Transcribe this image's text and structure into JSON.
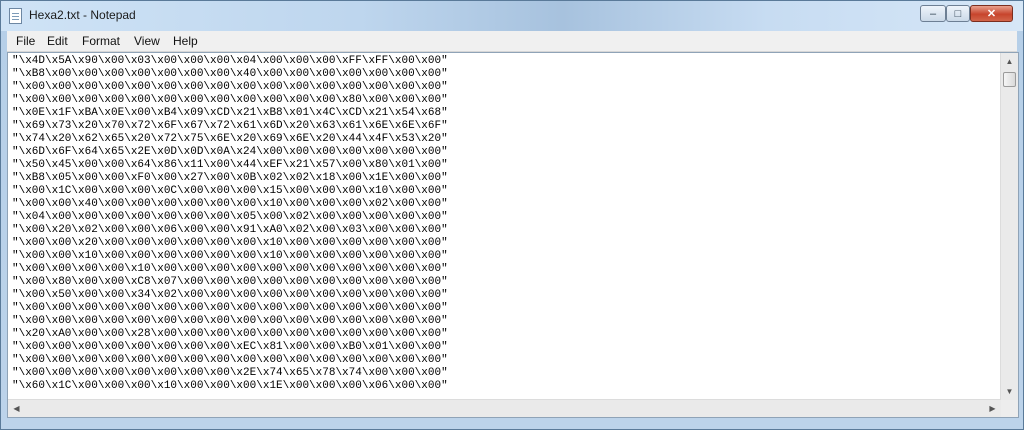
{
  "window": {
    "title": "Hexa2.txt - Notepad"
  },
  "menu": [
    "File",
    "Edit",
    "Format",
    "View",
    "Help"
  ],
  "controls": {
    "minimize": "–",
    "maximize": "□",
    "close": "✕"
  },
  "icons": {
    "app": "notepad-icon",
    "up": "▲",
    "down": "▼",
    "left": "◀",
    "right": "▶"
  },
  "editor": {
    "lines": [
      "\"\\x4D\\x5A\\x90\\x00\\x03\\x00\\x00\\x00\\x04\\x00\\x00\\x00\\xFF\\xFF\\x00\\x00\"",
      "\"\\xB8\\x00\\x00\\x00\\x00\\x00\\x00\\x00\\x40\\x00\\x00\\x00\\x00\\x00\\x00\\x00\"",
      "\"\\x00\\x00\\x00\\x00\\x00\\x00\\x00\\x00\\x00\\x00\\x00\\x00\\x00\\x00\\x00\\x00\"",
      "\"\\x00\\x00\\x00\\x00\\x00\\x00\\x00\\x00\\x00\\x00\\x00\\x00\\x80\\x00\\x00\\x00\"",
      "\"\\x0E\\x1F\\xBA\\x0E\\x00\\xB4\\x09\\xCD\\x21\\xB8\\x01\\x4C\\xCD\\x21\\x54\\x68\"",
      "\"\\x69\\x73\\x20\\x70\\x72\\x6F\\x67\\x72\\x61\\x6D\\x20\\x63\\x61\\x6E\\x6E\\x6F\"",
      "\"\\x74\\x20\\x62\\x65\\x20\\x72\\x75\\x6E\\x20\\x69\\x6E\\x20\\x44\\x4F\\x53\\x20\"",
      "\"\\x6D\\x6F\\x64\\x65\\x2E\\x0D\\x0D\\x0A\\x24\\x00\\x00\\x00\\x00\\x00\\x00\\x00\"",
      "\"\\x50\\x45\\x00\\x00\\x64\\x86\\x11\\x00\\x44\\xEF\\x21\\x57\\x00\\x80\\x01\\x00\"",
      "\"\\xB8\\x05\\x00\\x00\\xF0\\x00\\x27\\x00\\x0B\\x02\\x02\\x18\\x00\\x1E\\x00\\x00\"",
      "\"\\x00\\x1C\\x00\\x00\\x00\\x0C\\x00\\x00\\x00\\x15\\x00\\x00\\x00\\x10\\x00\\x00\"",
      "\"\\x00\\x00\\x40\\x00\\x00\\x00\\x00\\x00\\x00\\x10\\x00\\x00\\x00\\x02\\x00\\x00\"",
      "\"\\x04\\x00\\x00\\x00\\x00\\x00\\x00\\x00\\x05\\x00\\x02\\x00\\x00\\x00\\x00\\x00\"",
      "\"\\x00\\x20\\x02\\x00\\x00\\x06\\x00\\x00\\x91\\xA0\\x02\\x00\\x03\\x00\\x00\\x00\"",
      "\"\\x00\\x00\\x20\\x00\\x00\\x00\\x00\\x00\\x00\\x10\\x00\\x00\\x00\\x00\\x00\\x00\"",
      "\"\\x00\\x00\\x10\\x00\\x00\\x00\\x00\\x00\\x00\\x10\\x00\\x00\\x00\\x00\\x00\\x00\"",
      "\"\\x00\\x00\\x00\\x00\\x10\\x00\\x00\\x00\\x00\\x00\\x00\\x00\\x00\\x00\\x00\\x00\"",
      "\"\\x00\\x80\\x00\\x00\\xC8\\x07\\x00\\x00\\x00\\x00\\x00\\x00\\x00\\x00\\x00\\x00\"",
      "\"\\x00\\x50\\x00\\x00\\x34\\x02\\x00\\x00\\x00\\x00\\x00\\x00\\x00\\x00\\x00\\x00\"",
      "\"\\x00\\x00\\x00\\x00\\x00\\x00\\x00\\x00\\x00\\x00\\x00\\x00\\x00\\x00\\x00\\x00\"",
      "\"\\x00\\x00\\x00\\x00\\x00\\x00\\x00\\x00\\x00\\x00\\x00\\x00\\x00\\x00\\x00\\x00\"",
      "\"\\x20\\xA0\\x00\\x00\\x28\\x00\\x00\\x00\\x00\\x00\\x00\\x00\\x00\\x00\\x00\\x00\"",
      "\"\\x00\\x00\\x00\\x00\\x00\\x00\\x00\\x00\\xEC\\x81\\x00\\x00\\xB0\\x01\\x00\\x00\"",
      "\"\\x00\\x00\\x00\\x00\\x00\\x00\\x00\\x00\\x00\\x00\\x00\\x00\\x00\\x00\\x00\\x00\"",
      "\"\\x00\\x00\\x00\\x00\\x00\\x00\\x00\\x00\\x2E\\x74\\x65\\x78\\x74\\x00\\x00\\x00\"",
      "\"\\x60\\x1C\\x00\\x00\\x00\\x10\\x00\\x00\\x00\\x1E\\x00\\x00\\x00\\x06\\x00\\x00\""
    ]
  }
}
